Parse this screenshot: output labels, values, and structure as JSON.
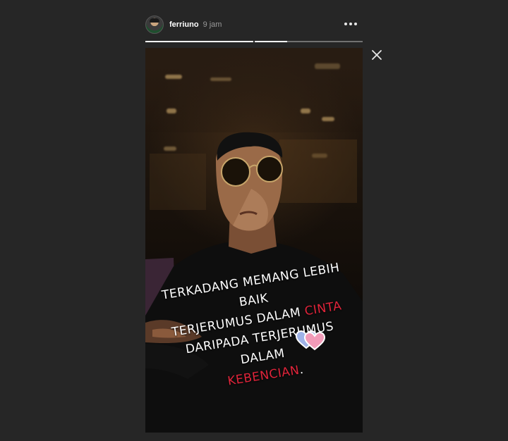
{
  "header": {
    "username": "ferriuno",
    "timestamp": "9 jam",
    "more_icon": "more-horizontal-icon"
  },
  "progress": {
    "segments": [
      1.0,
      0.3
    ],
    "color_active": "#ffffff",
    "color_track": "#6b6b6b"
  },
  "close_icon": "close-icon",
  "story": {
    "caption": {
      "line1": "TERKADANG MEMANG LEBIH BAIK",
      "line2_a": "TERJERUMUS DALAM ",
      "line2_b": "CINTA",
      "line3": "DARIPADA TERJERUMUS DALAM",
      "line4_a": "KEBENCIAN",
      "line4_b": "."
    },
    "highlight_color": "#e0243a",
    "sticker": "hearts-sticker-icon"
  },
  "colors": {
    "background": "#262626",
    "text": "#ffffff",
    "muted": "#9a9a9a"
  }
}
